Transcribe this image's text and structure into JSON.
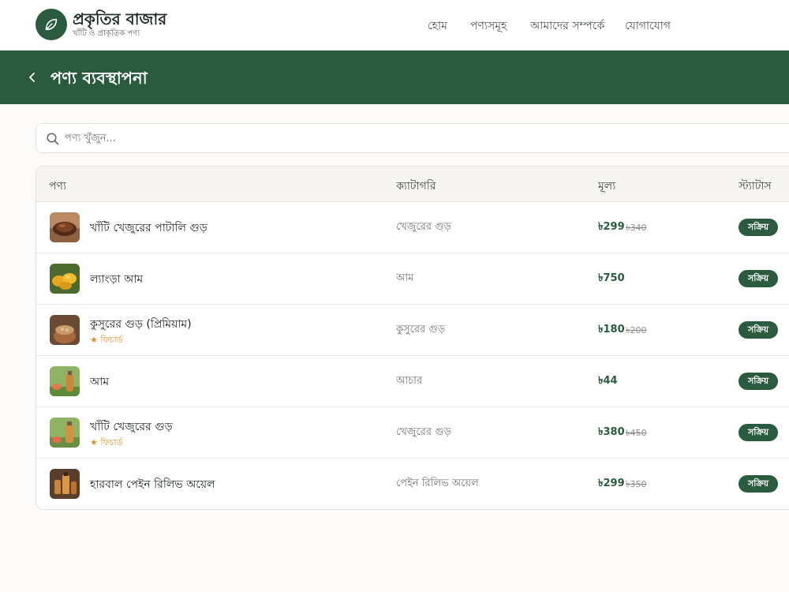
{
  "brand": {
    "title": "প্রকৃতির বাজার",
    "tagline": "খাঁটি ও প্রাকৃতিক পণ্য"
  },
  "nav": [
    "হোম",
    "পণ্যসমূহ",
    "আমাদের সম্পর্কে",
    "যোগাযোগ"
  ],
  "page": {
    "title": "পণ্য ব্যবস্থাপনা"
  },
  "search": {
    "placeholder": "পণ্য খুঁজুন..."
  },
  "table": {
    "headers": [
      "পণ্য",
      "ক্যাটাগরি",
      "মূল্য",
      "স্ট্যাটাস"
    ],
    "rows": [
      {
        "name": "খাঁটি খেজুরের পাটালি গুড়",
        "featured": "",
        "category": "খেজুরের গুড়",
        "price": "৳299",
        "old_price": "৳340",
        "status": "সক্রিয়",
        "thumb": "jaggery-bowl"
      },
      {
        "name": "ল্যাংড়া আম",
        "featured": "",
        "category": "আম",
        "price": "৳750",
        "old_price": "",
        "status": "সক্রিয়",
        "thumb": "mangoes"
      },
      {
        "name": "কুসুরের গুড় (প্রিমিয়াম)",
        "featured": "★ ফিচার্ড",
        "category": "কুসুরের গুড়",
        "price": "৳180",
        "old_price": "৳200",
        "status": "সক্রিয়",
        "thumb": "jaggery-pot"
      },
      {
        "name": "আম",
        "featured": "",
        "category": "আচার",
        "price": "৳44",
        "old_price": "",
        "status": "সক্রিয়",
        "thumb": "pickle-bottle"
      },
      {
        "name": "খাঁটি খেজুরের গুড়",
        "featured": "★ ফিচার্ড",
        "category": "খেজুরের গুড়",
        "price": "৳380",
        "old_price": "৳450",
        "status": "সক্রিয়",
        "thumb": "juice-bottle"
      },
      {
        "name": "হারবাল পেইন রিলিভ অয়েল",
        "featured": "",
        "category": "পেইন রিলিভ অয়েল",
        "price": "৳299",
        "old_price": "৳350",
        "status": "সক্রিয়",
        "thumb": "oil-bottles"
      }
    ]
  },
  "colors": {
    "primary": "#2b5b3f",
    "accent": "#d9912f",
    "background": "#fcfbf9"
  },
  "icons": {
    "logo": "leaf-icon",
    "back": "chevron-left-icon",
    "search": "search-icon"
  }
}
